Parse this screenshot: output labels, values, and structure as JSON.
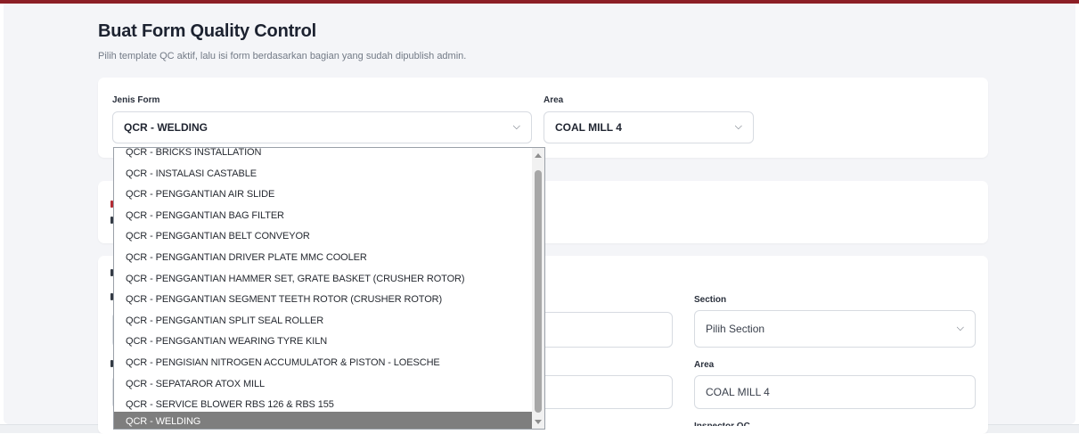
{
  "page": {
    "title": "Buat Form Quality Control",
    "subtitle": "Pilih template QC aktif, lalu isi form berdasarkan bagian yang sudah dipublish admin."
  },
  "form_selector": {
    "jenis_form_label": "Jenis Form",
    "jenis_form_value": "QCR - WELDING",
    "area_label": "Area",
    "area_value": "COAL MILL 4"
  },
  "details": {
    "section_label": "Section",
    "section_placeholder": "Pilih Section",
    "area_label": "Area",
    "area_value": "COAL MILL 4",
    "inspector_label": "Inspector QC"
  },
  "dropdown": {
    "options": [
      "QCR - BRICKS INSTALLATION",
      "QCR - INSTALASI CASTABLE",
      "QCR - PENGGANTIAN AIR SLIDE",
      "QCR - PENGGANTIAN BAG FILTER",
      "QCR - PENGGANTIAN BELT CONVEYOR",
      "QCR - PENGGANTIAN DRIVER PLATE MMC COOLER",
      "QCR - PENGGANTIAN HAMMER SET, GRATE BASKET (CRUSHER ROTOR)",
      "QCR - PENGGANTIAN SEGMENT TEETH ROTOR (CRUSHER ROTOR)",
      "QCR - PENGGANTIAN SPLIT SEAL ROLLER",
      "QCR - PENGGANTIAN WEARING TYRE KILN",
      "QCR - PENGISIAN NITROGEN ACCUMULATOR & PISTON - LOESCHE",
      "QCR - SEPATAROR ATOX MILL",
      "QCR - SERVICE BLOWER RBS 126 & RBS 155",
      "QCR - WELDING"
    ],
    "selected": "QCR - WELDING"
  },
  "icons": {
    "select_chevron": "chevron-down-icon",
    "scroll_up": "scroll-up-arrow-icon",
    "scroll_down": "scroll-down-arrow-icon"
  },
  "colors": {
    "accent_bar": "#8c1f26",
    "selected_option_bg": "#7e7e7e",
    "page_bg": "#f4f5f8"
  }
}
